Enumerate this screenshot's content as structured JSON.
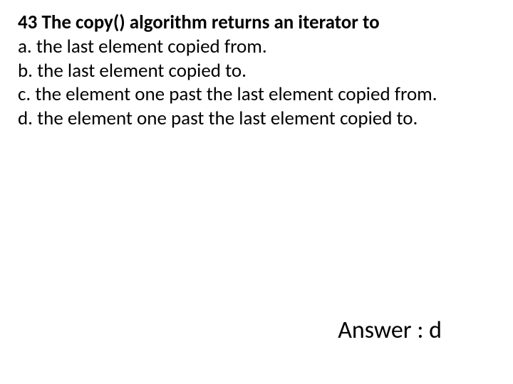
{
  "question": {
    "number_and_text": "43 The copy() algorithm returns an iterator to",
    "options": {
      "a": "a. the last element copied from.",
      "b": "b. the last element copied to.",
      "c": "c. the element one past the last element copied from.",
      "d": "d. the element one past the last element copied to."
    }
  },
  "answer": {
    "label": "Answer : d"
  }
}
